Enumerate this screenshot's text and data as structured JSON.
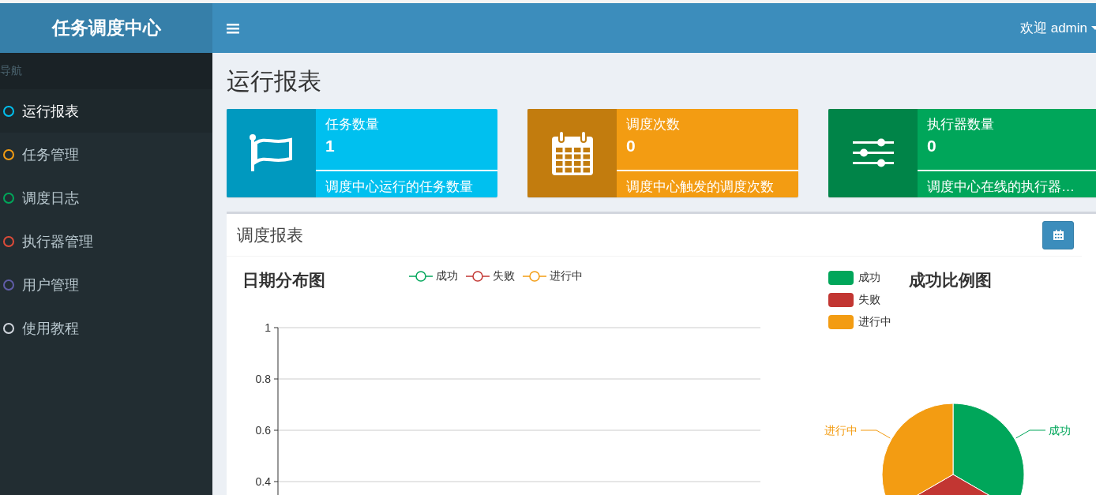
{
  "sidebar": {
    "logo": "任务调度中心",
    "section_label": "导航",
    "items": [
      {
        "label": "运行报表",
        "selected": true,
        "color": "#00c0ef"
      },
      {
        "label": "任务管理",
        "selected": false,
        "color": "#f39c12"
      },
      {
        "label": "调度日志",
        "selected": false,
        "color": "#00a65a"
      },
      {
        "label": "执行器管理",
        "selected": false,
        "color": "#dd4b39"
      },
      {
        "label": "用户管理",
        "selected": false,
        "color": "#605ca8"
      },
      {
        "label": "使用教程",
        "selected": false,
        "color": "#d2d6de"
      }
    ]
  },
  "header": {
    "user_menu": "欢迎 admin"
  },
  "page_title": "运行报表",
  "info_boxes": [
    {
      "kind": "flag",
      "title": "任务数量",
      "value": "1",
      "description": "调度中心运行的任务数量",
      "color": "#00c0ef"
    },
    {
      "kind": "calendar",
      "title": "调度次数",
      "value": "0",
      "description": "调度中心触发的调度次数",
      "color": "#f39c12"
    },
    {
      "kind": "sliders",
      "title": "执行器数量",
      "value": "0",
      "description": "调度中心在线的执行器…",
      "color": "#00a65a"
    }
  ],
  "report": {
    "title": "调度报表",
    "line_chart": {
      "chart_data": {
        "type": "line",
        "title": "日期分布图",
        "series": [
          {
            "name": "成功",
            "color": "#00a65a"
          },
          {
            "name": "失败",
            "color": "#c23632"
          },
          {
            "name": "进行中",
            "color": "#f39c12"
          }
        ],
        "yticks": [
          0.4,
          0.6,
          0.8,
          1
        ],
        "ylim": [
          0.26,
          1
        ],
        "legend": true,
        "grid": true
      }
    },
    "pie_chart": {
      "chart_data": {
        "type": "pie",
        "title": "成功比例图",
        "categories": [
          "成功",
          "失败",
          "进行中"
        ],
        "values": [
          33.33,
          33.33,
          33.34
        ],
        "legend": true,
        "colors": [
          "#00a65a",
          "#c23632",
          "#f39c12"
        ]
      }
    }
  }
}
